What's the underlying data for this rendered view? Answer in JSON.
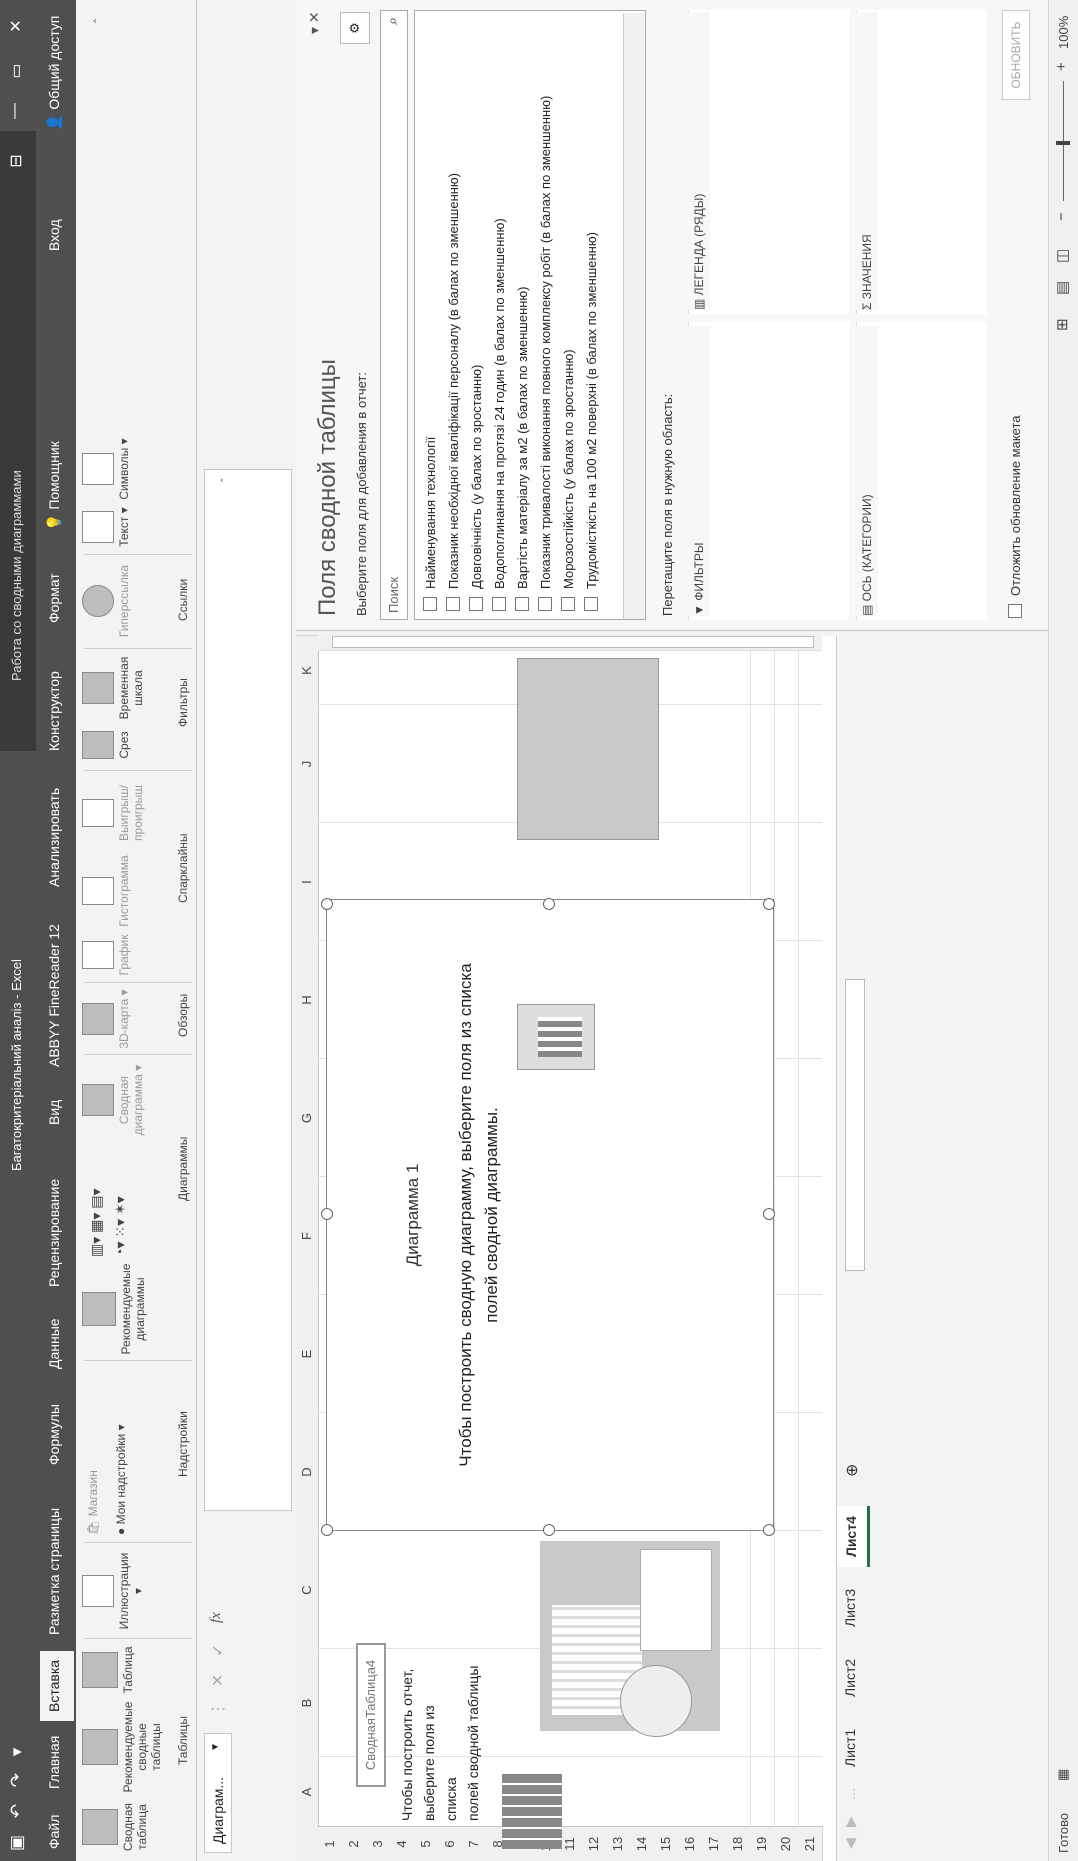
{
  "app": {
    "doc_title": "Багатокритеріальний аналіз - Excel",
    "context_title": "Работа со сводными диаграммами",
    "window_buttons": [
      "⊟",
      "—",
      "▭",
      "✕"
    ],
    "qat": "▣ ↶ ↷ ▾"
  },
  "tabs": [
    "Файл",
    "Главная",
    "Вставка",
    "Разметка страницы",
    "Формулы",
    "Данные",
    "Рецензирование",
    "Вид",
    "ABBYY FineReader 12",
    "Анализировать",
    "Конструктор",
    "Формат"
  ],
  "active_tab": "Вставка",
  "tell_me": "Помощник",
  "signin": "Вход",
  "share": "Общий доступ",
  "ribbon": {
    "tables": {
      "btn1": "Сводная таблица",
      "btn2": "Рекомендуемые сводные таблицы",
      "btn3": "Таблица",
      "label": "Таблицы"
    },
    "illustrations": {
      "btn": "Иллюстрации ▾"
    },
    "addins": {
      "store": "Магазин",
      "my": "Мои надстройки ▾",
      "label": "Надстройки"
    },
    "charts": {
      "recommended": "Рекомендуемые диаграммы",
      "pivot": "Сводная диаграмма ▾",
      "label": "Диаграммы"
    },
    "tours": {
      "map": "3D-карта ▾",
      "label": "Обзоры"
    },
    "sparklines": {
      "line": "График",
      "column": "Гистограмма",
      "winloss": "Выигрыш/ проигрыш",
      "label": "Спарклайны"
    },
    "filters": {
      "slicer": "Срез",
      "timeline": "Временная шкала",
      "label": "Фильтры"
    },
    "links": {
      "hyperlink": "Гиперссылка",
      "label": "Ссылки"
    },
    "text": {
      "btn": "Текст ▾"
    },
    "symbols": {
      "btn": "Символы ▾"
    }
  },
  "namebox": "Диаграм...",
  "fx": "fx",
  "columns": [
    "A",
    "B",
    "C",
    "D",
    "E",
    "F",
    "G",
    "H",
    "I",
    "J",
    "K"
  ],
  "rows": [
    "1",
    "2",
    "3",
    "4",
    "5",
    "6",
    "7",
    "8",
    "9",
    "10",
    "11",
    "12",
    "13",
    "14",
    "15",
    "16",
    "17",
    "18",
    "19",
    "20",
    "21"
  ],
  "pivot_table": {
    "name": "СводнаяТаблица4",
    "hint_lines": [
      "Чтобы построить отчет,",
      "выберите поля из списка",
      "полей сводной таблицы"
    ]
  },
  "chart": {
    "title": "Диаграмма 1",
    "hint_lines": [
      "Чтобы построить сводную диаграмму, выберите поля из списка",
      "полей сводной диаграммы."
    ]
  },
  "sheets": [
    "Лист1",
    "Лист2",
    "Лист3",
    "Лист4"
  ],
  "active_sheet": "Лист4",
  "status": {
    "ready": "Готово",
    "zoom": "100%"
  },
  "pane": {
    "title": "Поля сводной таблицы",
    "subtitle": "Выберите поля для добавления в отчет:",
    "search_placeholder": "Поиск",
    "fields": [
      "Найменування технології",
      "Показник необхідної кваліфікації персоналу (в балах по зменшенню)",
      "Довговічність (у балах по зростанню)",
      "Водопоглинання на протязі 24 годин (в балах по зменшенню)",
      "Вартість матеріалу за м2 (в балах по зменшенню)",
      "Показник тривалості виконання повного комплексу робіт (в балах по зменшенню)",
      "Морозостійкість (у балах по зростанню)",
      "Трудомісткість на 100 м2 поверхні (в балах по зменшенню)"
    ],
    "drag_hint": "Перетащите поля в нужную область:",
    "areas": {
      "filters": "ФИЛЬТРЫ",
      "legend": "ЛЕГЕНДА (РЯДЫ)",
      "axis": "ОСЬ (КАТЕГОРИИ)",
      "values": "ЗНАЧЕНИЯ"
    },
    "defer": "Отложить обновление макета",
    "update": "ОБНОВИТЬ"
  }
}
